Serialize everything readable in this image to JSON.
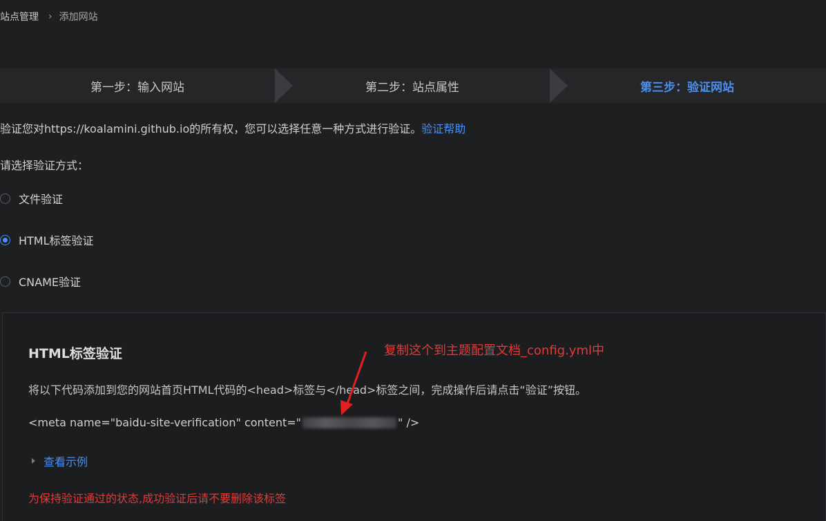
{
  "breadcrumb": {
    "parent": "站点管理",
    "current": "添加网站"
  },
  "steps": [
    {
      "label": "第一步：输入网站",
      "active": false
    },
    {
      "label": "第二步：站点属性",
      "active": false
    },
    {
      "label": "第三步：验证网站",
      "active": true
    }
  ],
  "intro": {
    "text": "验证您对https://koalamini.github.io的所有权，您可以选择任意一种方式进行验证。",
    "help_link": "验证帮助"
  },
  "choose_label": "请选择验证方式：",
  "methods": [
    {
      "label": "文件验证",
      "selected": false
    },
    {
      "label": "HTML标签验证",
      "selected": true
    },
    {
      "label": "CNAME验证",
      "selected": false
    }
  ],
  "panel": {
    "title": "HTML标签验证",
    "annotation": "复制这个到主题配置文档_config.yml中",
    "description": "将以下代码添加到您的网站首页HTML代码的<head>标签与</head>标签之间，完成操作后请点击“验证”按钮。",
    "code_prefix": "<meta name=\"baidu-site-verification\" content=\"",
    "code_suffix": "\" />",
    "example_link": "查看示例",
    "warning": "为保持验证通过的状态,成功验证后请不要删除该标签"
  },
  "colors": {
    "accent": "#4b8ff0",
    "warning": "#e03b3b",
    "background": "#1e1f21"
  }
}
